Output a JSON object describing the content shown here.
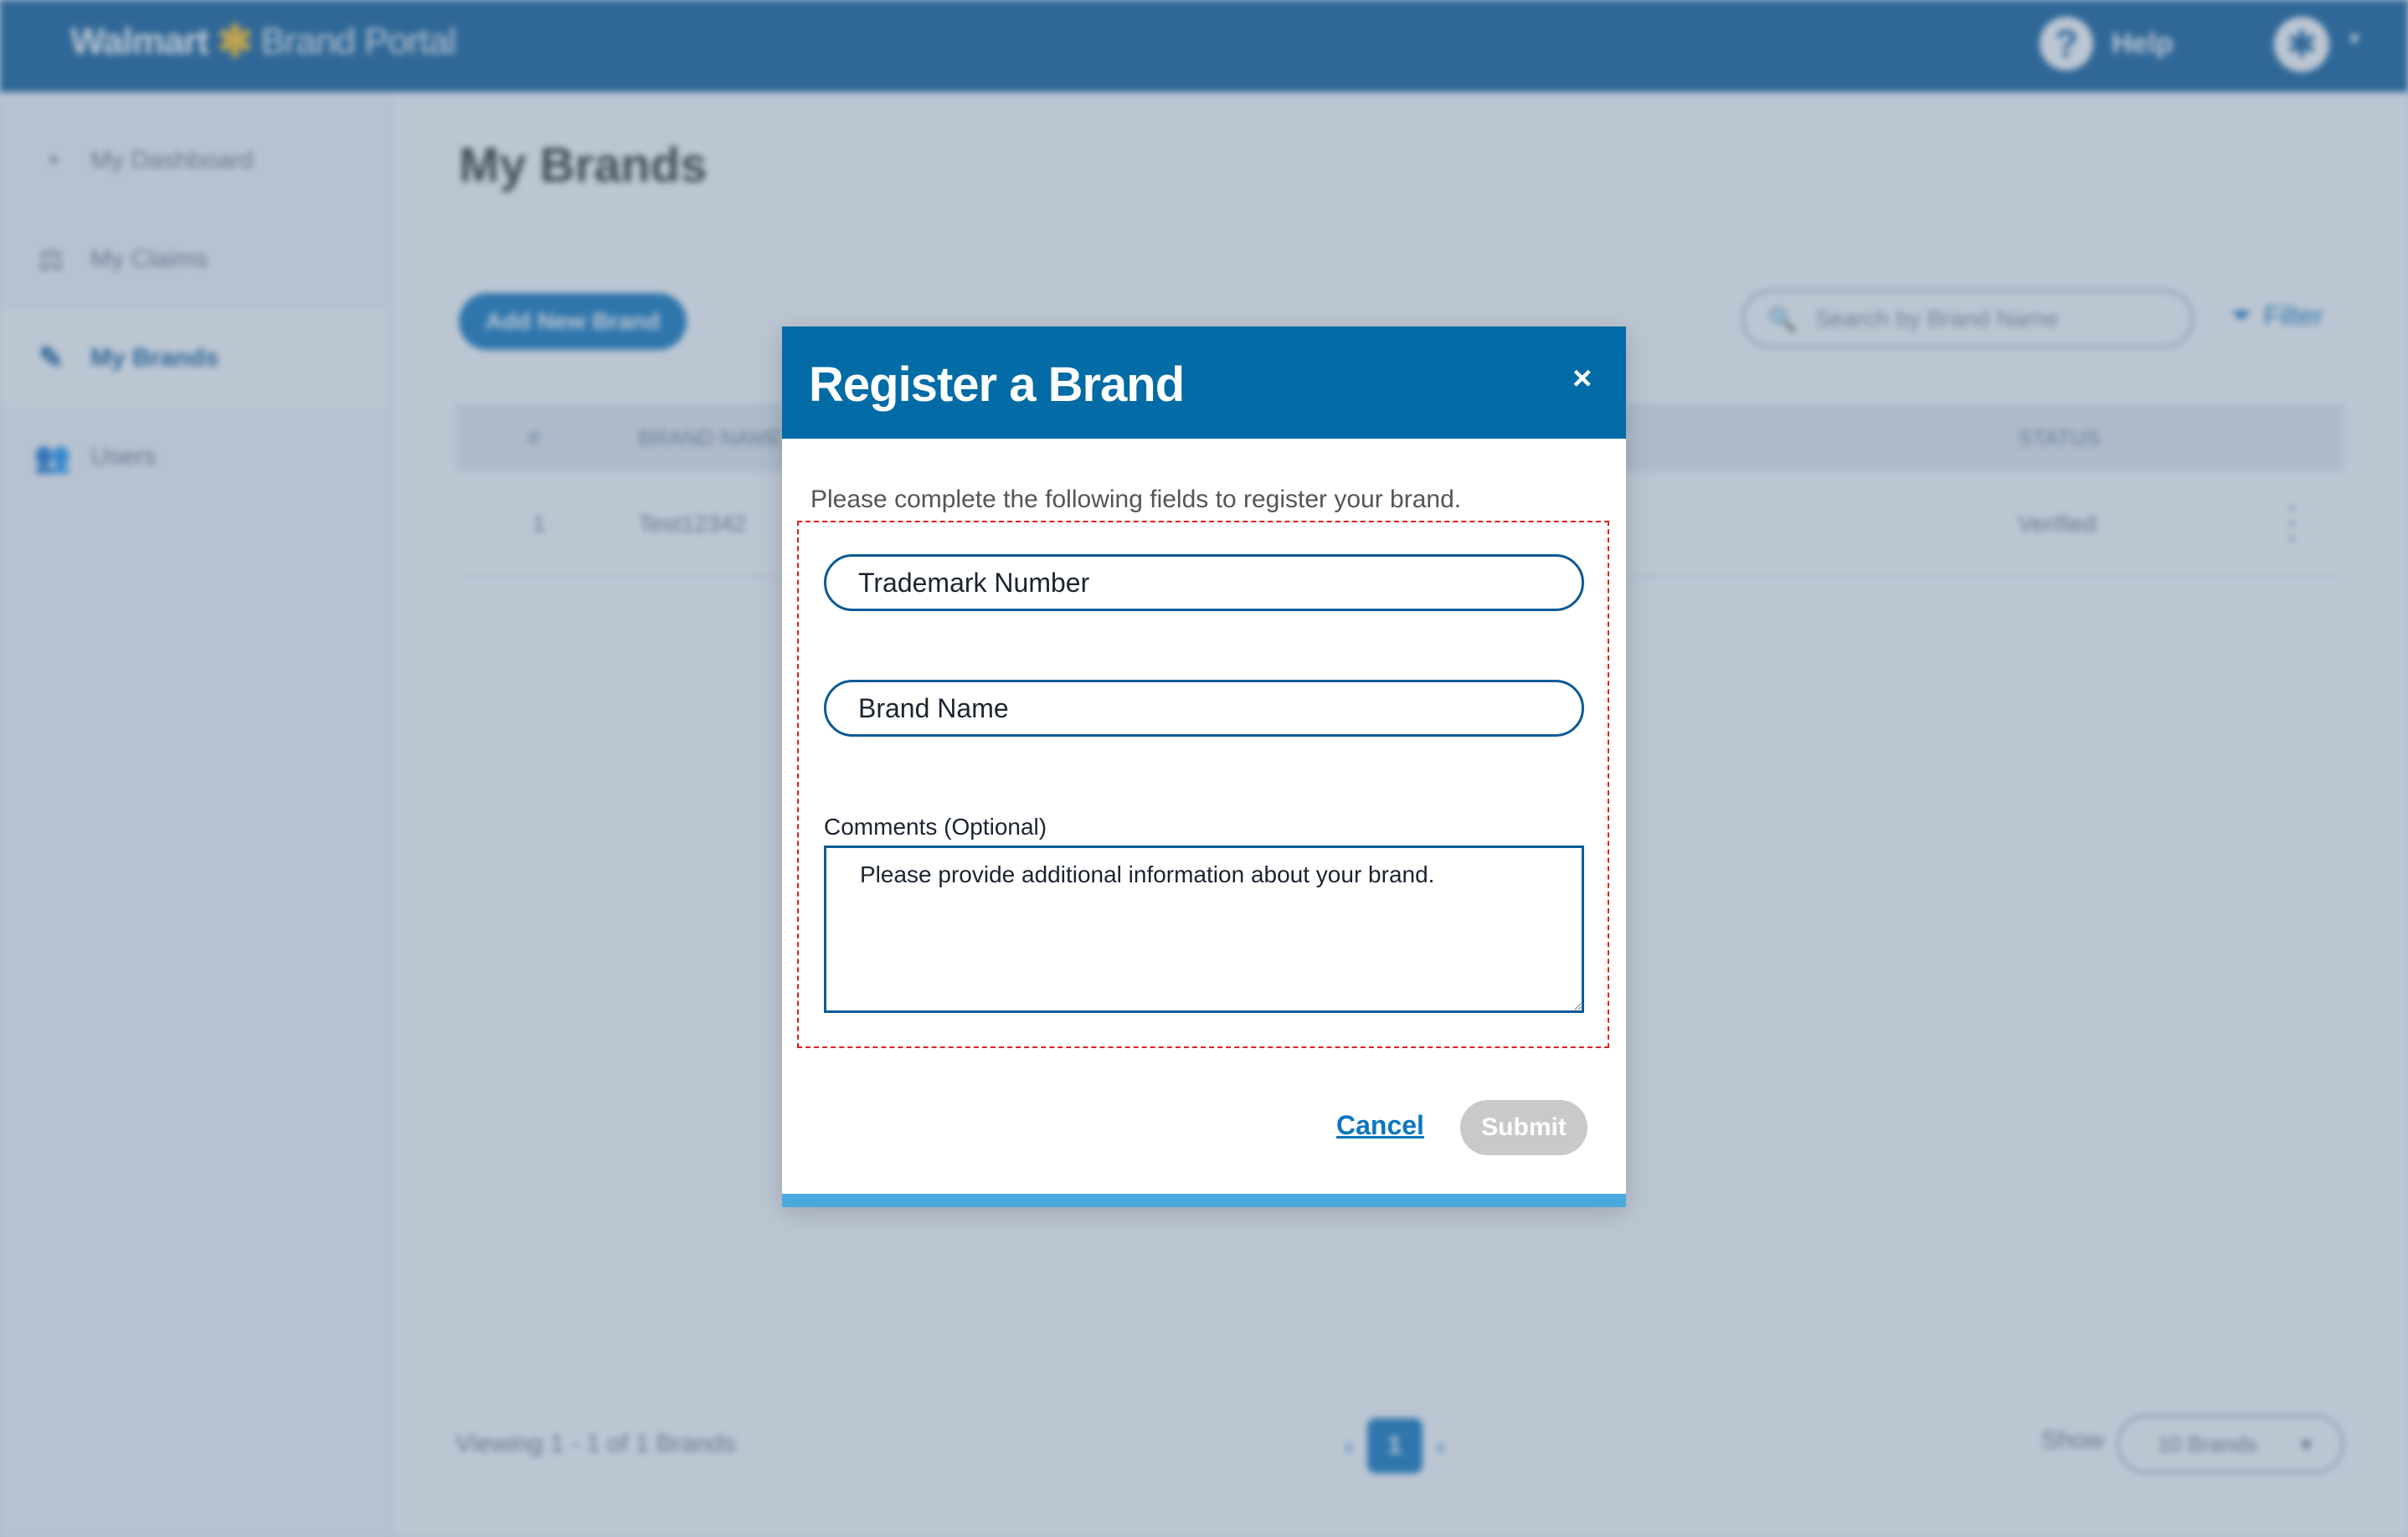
{
  "header": {
    "logo_text": "Walmart",
    "logo_portal": "Brand Portal",
    "help_label": "Help",
    "avatar_icon": "walmart-spark-icon"
  },
  "sidebar": {
    "items": [
      {
        "label": "My Dashboard",
        "icon": "dashboard-icon"
      },
      {
        "label": "My Claims",
        "icon": "claims-icon"
      },
      {
        "label": "My Brands",
        "icon": "brands-icon",
        "active": true
      },
      {
        "label": "Users",
        "icon": "users-icon"
      }
    ]
  },
  "main": {
    "title": "My Brands",
    "add_button": "Add New Brand",
    "search_placeholder": "Search by Brand Name",
    "filter_label": "Filter",
    "table": {
      "columns": [
        "#",
        "BRAND NAME",
        "STATUS"
      ],
      "rows": [
        {
          "index": "1",
          "brand": "Test12342",
          "status": "Verified"
        }
      ]
    },
    "viewing": "Viewing 1 - 1 of 1 Brands",
    "page": "1",
    "show_label": "Show",
    "show_value": "10 Brands"
  },
  "modal": {
    "title": "Register a Brand",
    "close_symbol": "×",
    "intro": "Please complete the following fields to register your brand.",
    "trademark_placeholder": "Trademark Number",
    "brand_name_placeholder": "Brand Name",
    "comments_label": "Comments (Optional)",
    "comments_placeholder": "Please provide additional information about your brand.",
    "cancel_label": "Cancel",
    "submit_label": "Submit"
  },
  "colors": {
    "header_blue": "#036ba5",
    "accent": "#0d76bd",
    "highlight_red": "#e02020",
    "disabled_grey": "#c9c9c9"
  }
}
